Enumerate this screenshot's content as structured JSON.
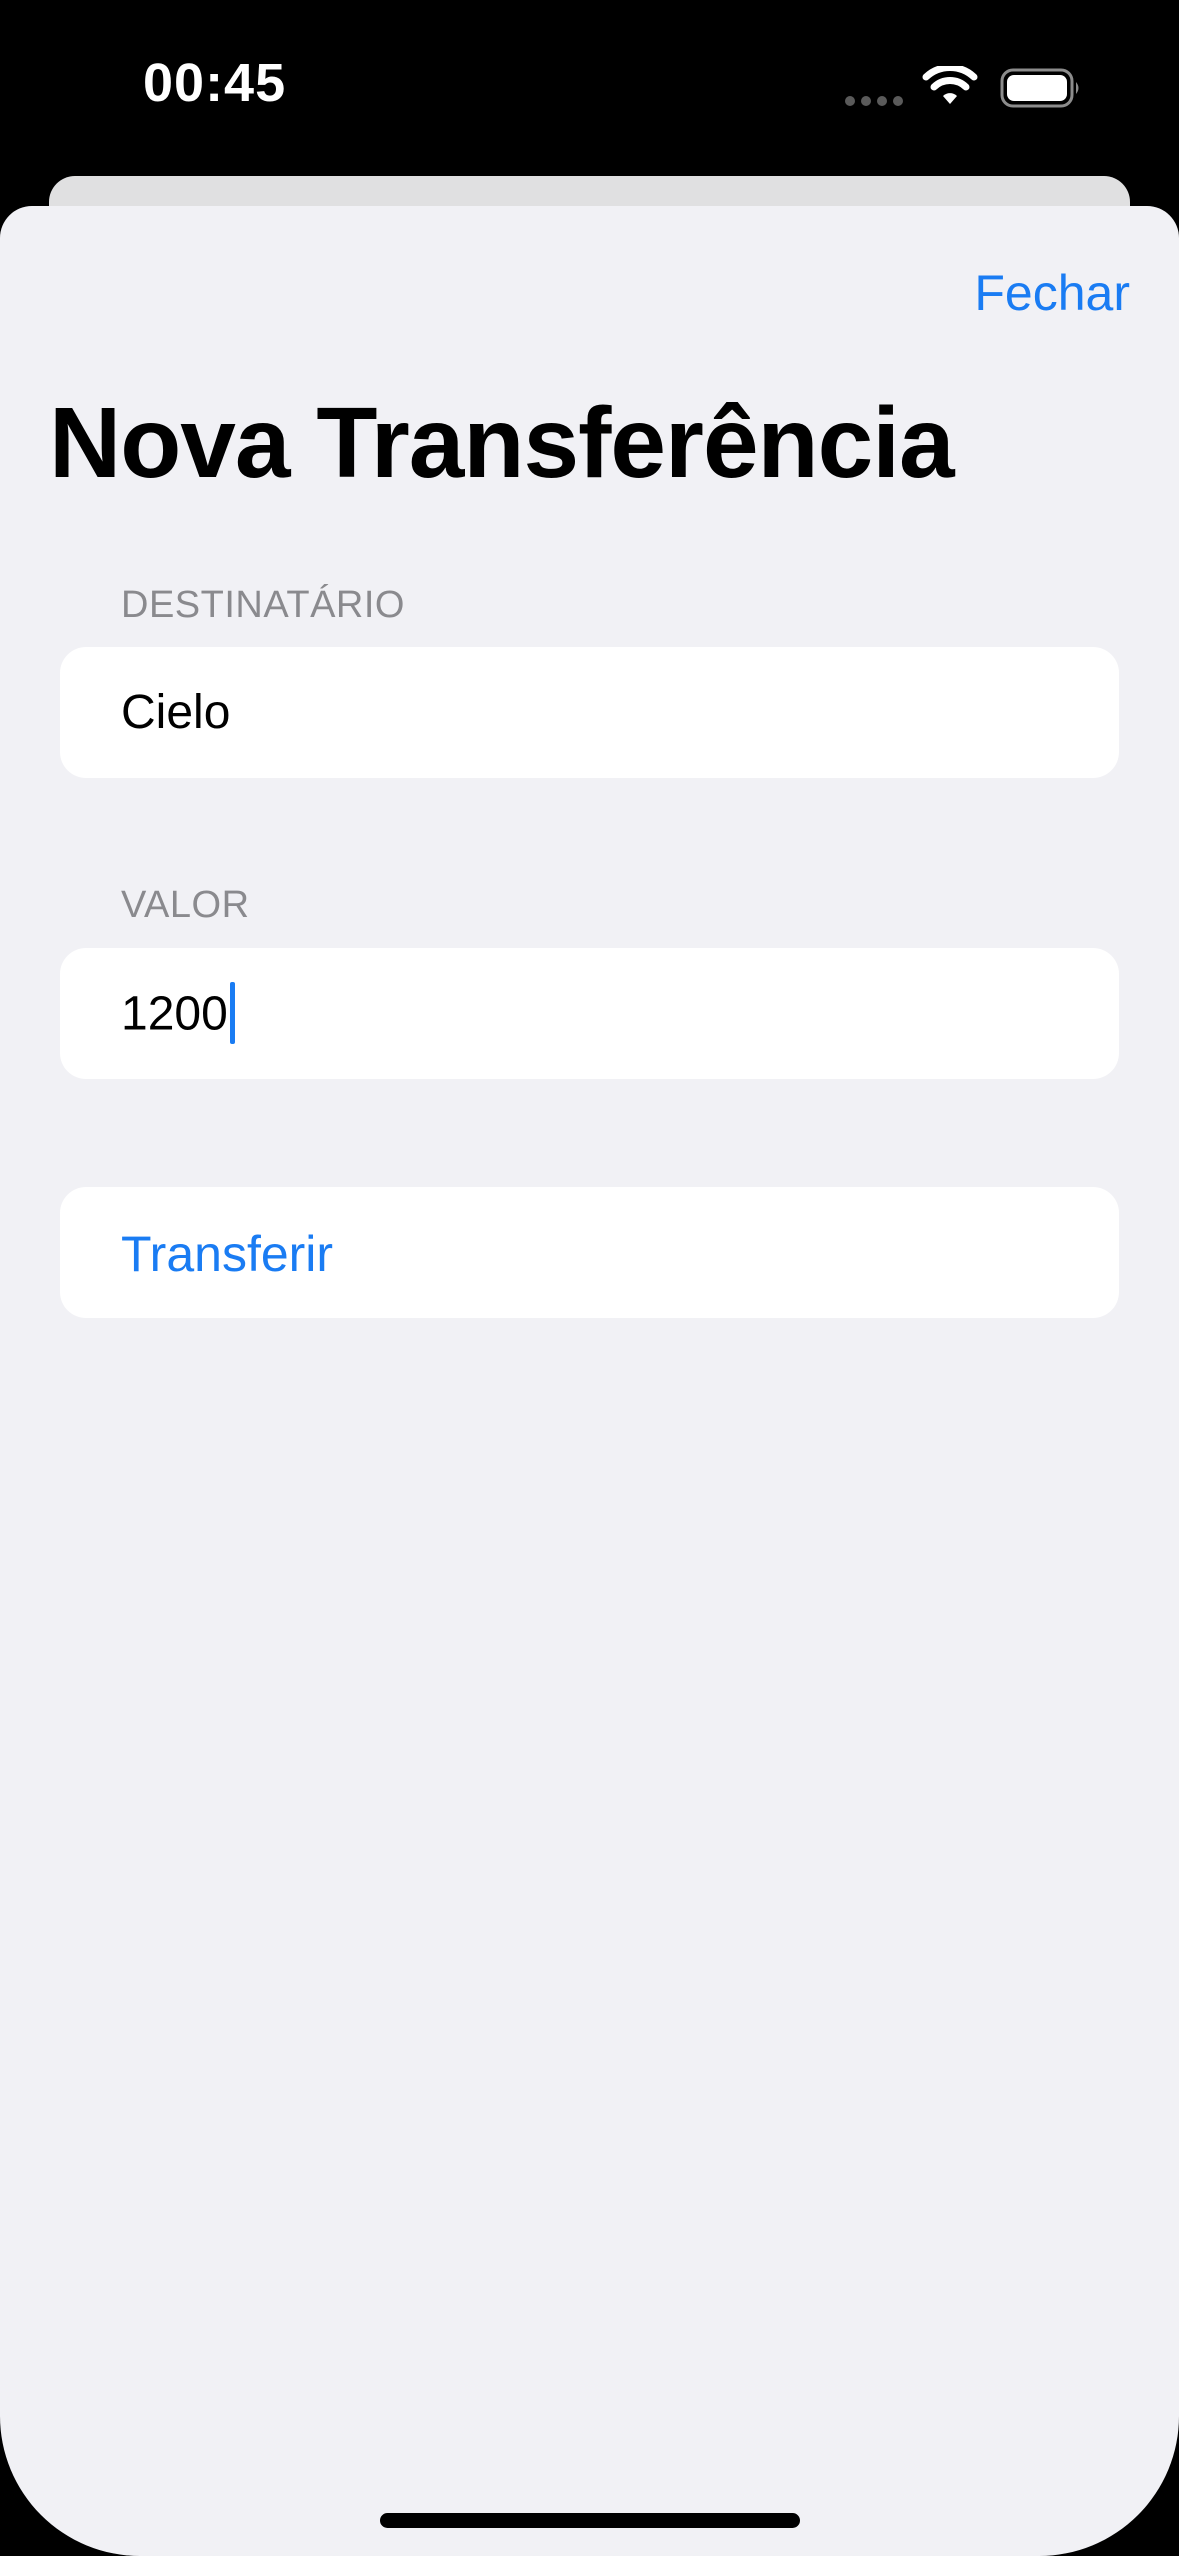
{
  "status_bar": {
    "time": "00:45",
    "wifi_icon": "wifi-icon",
    "battery_icon": "battery-icon",
    "signal_icon": "cellular-signal-icon"
  },
  "nav": {
    "close_label": "Fechar"
  },
  "page": {
    "title": "Nova Transferência"
  },
  "form": {
    "recipient": {
      "header": "DESTINATÁRIO",
      "value": "Cielo"
    },
    "amount": {
      "header": "VALOR",
      "value": "1200"
    },
    "submit_label": "Transferir"
  },
  "colors": {
    "accent": "#1a7cf3",
    "background": "#f1f1f5",
    "card": "#ffffff",
    "section_header": "#8a8a8e"
  }
}
